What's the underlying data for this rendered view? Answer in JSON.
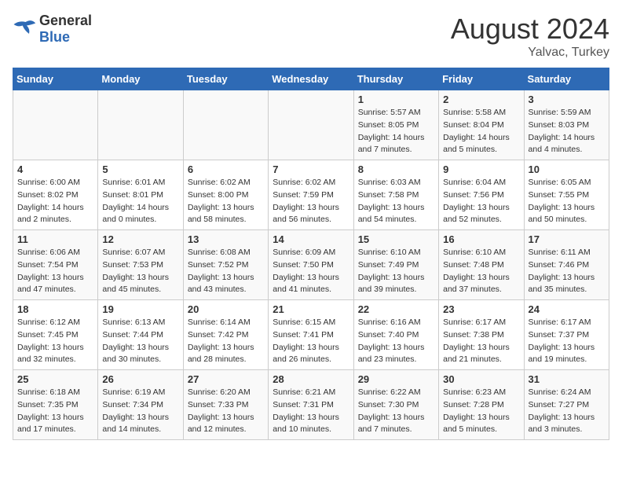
{
  "header": {
    "logo_general": "General",
    "logo_blue": "Blue",
    "title": "August 2024",
    "location": "Yalvac, Turkey"
  },
  "days_of_week": [
    "Sunday",
    "Monday",
    "Tuesday",
    "Wednesday",
    "Thursday",
    "Friday",
    "Saturday"
  ],
  "weeks": [
    [
      {
        "day": "",
        "info": ""
      },
      {
        "day": "",
        "info": ""
      },
      {
        "day": "",
        "info": ""
      },
      {
        "day": "",
        "info": ""
      },
      {
        "day": "1",
        "info": "Sunrise: 5:57 AM\nSunset: 8:05 PM\nDaylight: 14 hours and 7 minutes."
      },
      {
        "day": "2",
        "info": "Sunrise: 5:58 AM\nSunset: 8:04 PM\nDaylight: 14 hours and 5 minutes."
      },
      {
        "day": "3",
        "info": "Sunrise: 5:59 AM\nSunset: 8:03 PM\nDaylight: 14 hours and 4 minutes."
      }
    ],
    [
      {
        "day": "4",
        "info": "Sunrise: 6:00 AM\nSunset: 8:02 PM\nDaylight: 14 hours and 2 minutes."
      },
      {
        "day": "5",
        "info": "Sunrise: 6:01 AM\nSunset: 8:01 PM\nDaylight: 14 hours and 0 minutes."
      },
      {
        "day": "6",
        "info": "Sunrise: 6:02 AM\nSunset: 8:00 PM\nDaylight: 13 hours and 58 minutes."
      },
      {
        "day": "7",
        "info": "Sunrise: 6:02 AM\nSunset: 7:59 PM\nDaylight: 13 hours and 56 minutes."
      },
      {
        "day": "8",
        "info": "Sunrise: 6:03 AM\nSunset: 7:58 PM\nDaylight: 13 hours and 54 minutes."
      },
      {
        "day": "9",
        "info": "Sunrise: 6:04 AM\nSunset: 7:56 PM\nDaylight: 13 hours and 52 minutes."
      },
      {
        "day": "10",
        "info": "Sunrise: 6:05 AM\nSunset: 7:55 PM\nDaylight: 13 hours and 50 minutes."
      }
    ],
    [
      {
        "day": "11",
        "info": "Sunrise: 6:06 AM\nSunset: 7:54 PM\nDaylight: 13 hours and 47 minutes."
      },
      {
        "day": "12",
        "info": "Sunrise: 6:07 AM\nSunset: 7:53 PM\nDaylight: 13 hours and 45 minutes."
      },
      {
        "day": "13",
        "info": "Sunrise: 6:08 AM\nSunset: 7:52 PM\nDaylight: 13 hours and 43 minutes."
      },
      {
        "day": "14",
        "info": "Sunrise: 6:09 AM\nSunset: 7:50 PM\nDaylight: 13 hours and 41 minutes."
      },
      {
        "day": "15",
        "info": "Sunrise: 6:10 AM\nSunset: 7:49 PM\nDaylight: 13 hours and 39 minutes."
      },
      {
        "day": "16",
        "info": "Sunrise: 6:10 AM\nSunset: 7:48 PM\nDaylight: 13 hours and 37 minutes."
      },
      {
        "day": "17",
        "info": "Sunrise: 6:11 AM\nSunset: 7:46 PM\nDaylight: 13 hours and 35 minutes."
      }
    ],
    [
      {
        "day": "18",
        "info": "Sunrise: 6:12 AM\nSunset: 7:45 PM\nDaylight: 13 hours and 32 minutes."
      },
      {
        "day": "19",
        "info": "Sunrise: 6:13 AM\nSunset: 7:44 PM\nDaylight: 13 hours and 30 minutes."
      },
      {
        "day": "20",
        "info": "Sunrise: 6:14 AM\nSunset: 7:42 PM\nDaylight: 13 hours and 28 minutes."
      },
      {
        "day": "21",
        "info": "Sunrise: 6:15 AM\nSunset: 7:41 PM\nDaylight: 13 hours and 26 minutes."
      },
      {
        "day": "22",
        "info": "Sunrise: 6:16 AM\nSunset: 7:40 PM\nDaylight: 13 hours and 23 minutes."
      },
      {
        "day": "23",
        "info": "Sunrise: 6:17 AM\nSunset: 7:38 PM\nDaylight: 13 hours and 21 minutes."
      },
      {
        "day": "24",
        "info": "Sunrise: 6:17 AM\nSunset: 7:37 PM\nDaylight: 13 hours and 19 minutes."
      }
    ],
    [
      {
        "day": "25",
        "info": "Sunrise: 6:18 AM\nSunset: 7:35 PM\nDaylight: 13 hours and 17 minutes."
      },
      {
        "day": "26",
        "info": "Sunrise: 6:19 AM\nSunset: 7:34 PM\nDaylight: 13 hours and 14 minutes."
      },
      {
        "day": "27",
        "info": "Sunrise: 6:20 AM\nSunset: 7:33 PM\nDaylight: 13 hours and 12 minutes."
      },
      {
        "day": "28",
        "info": "Sunrise: 6:21 AM\nSunset: 7:31 PM\nDaylight: 13 hours and 10 minutes."
      },
      {
        "day": "29",
        "info": "Sunrise: 6:22 AM\nSunset: 7:30 PM\nDaylight: 13 hours and 7 minutes."
      },
      {
        "day": "30",
        "info": "Sunrise: 6:23 AM\nSunset: 7:28 PM\nDaylight: 13 hours and 5 minutes."
      },
      {
        "day": "31",
        "info": "Sunrise: 6:24 AM\nSunset: 7:27 PM\nDaylight: 13 hours and 3 minutes."
      }
    ]
  ]
}
